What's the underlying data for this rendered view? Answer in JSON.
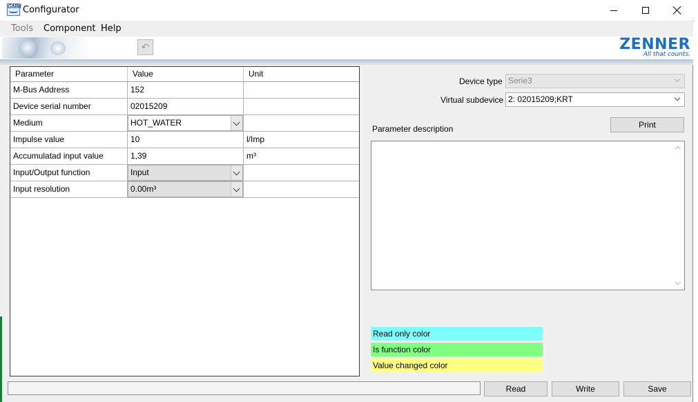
{
  "window": {
    "title": "Configurator",
    "icon_text": "GMM"
  },
  "menu": {
    "tools": "Tools",
    "component": "Component",
    "help": "Help"
  },
  "banner": {
    "logo_name": "ZENNER",
    "logo_tagline": "All that counts.",
    "undo_icon": "undo-icon"
  },
  "grid": {
    "headers": [
      "Parameter",
      "Value",
      "Unit"
    ],
    "rows": [
      {
        "parameter": "M-Bus Address",
        "value": "152",
        "unit": ""
      },
      {
        "parameter": "Device serial number",
        "value": "02015209",
        "unit": ""
      },
      {
        "parameter": "Medium",
        "value": "HOT_WATER",
        "unit": ""
      },
      {
        "parameter": "Impulse value",
        "value": "10",
        "unit": "l/Imp"
      },
      {
        "parameter": "Accumulatad input value",
        "value": "1,39",
        "unit": "m³"
      },
      {
        "parameter": "Input/Output function",
        "value": "Input",
        "unit": ""
      },
      {
        "parameter": "Input resolution",
        "value": "0.00m³",
        "unit": ""
      }
    ]
  },
  "right": {
    "device_type_label": "Device type",
    "device_type_value": "Serie3",
    "virtual_subdevice_label": "Virtual subdevice",
    "virtual_subdevice_value": "2: 02015209;KRT",
    "parameter_description_label": "Parameter description",
    "print_label": "Print"
  },
  "legend": {
    "read_only": {
      "label": "Read only color",
      "color": "#80ffff"
    },
    "is_function": {
      "label": "Is function color",
      "color": "#80ff80"
    },
    "value_changed": {
      "label": "Value changed color",
      "color": "#ffff80"
    }
  },
  "buttons": {
    "read": "Read",
    "write": "Write",
    "save": "Save"
  }
}
